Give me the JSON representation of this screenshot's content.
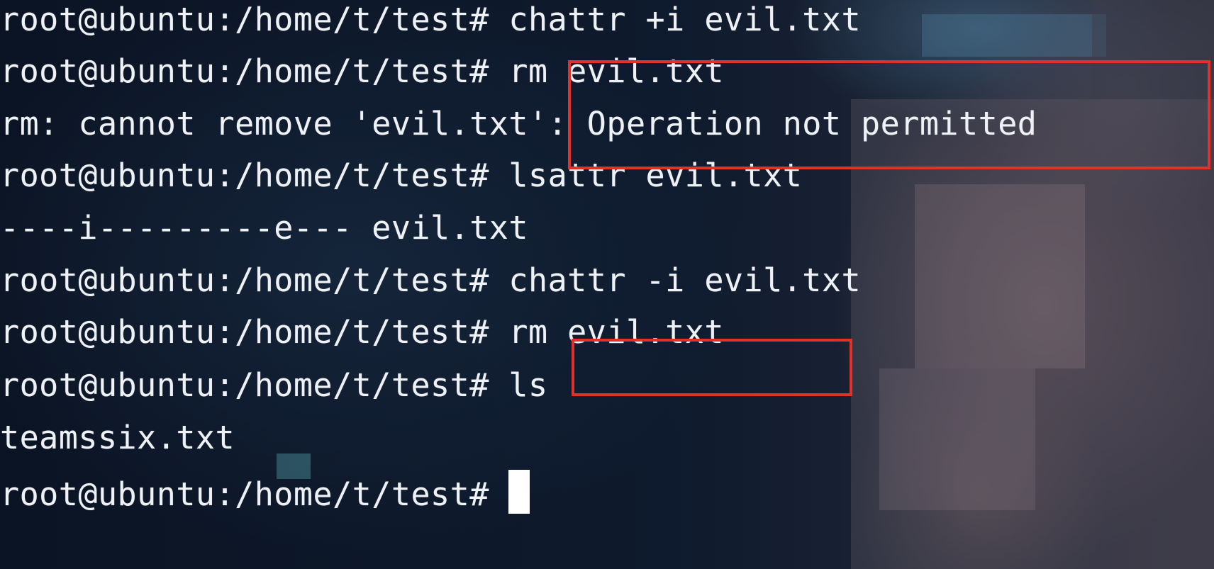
{
  "terminal": {
    "prompt": "root@ubuntu:/home/t/test# ",
    "lines": [
      {
        "prompt": "root@ubuntu:/home/t/test# ",
        "text": "chattr +i evil.txt"
      },
      {
        "prompt": "root@ubuntu:/home/t/test# ",
        "text": "rm evil.txt"
      },
      {
        "prompt": "",
        "text": "rm: cannot remove 'evil.txt': Operation not permitted"
      },
      {
        "prompt": "root@ubuntu:/home/t/test# ",
        "text": "lsattr evil.txt"
      },
      {
        "prompt": "",
        "text": "----i---------e--- evil.txt"
      },
      {
        "prompt": "root@ubuntu:/home/t/test# ",
        "text": "chattr -i evil.txt"
      },
      {
        "prompt": "root@ubuntu:/home/t/test# ",
        "text": "rm evil.txt"
      },
      {
        "prompt": "root@ubuntu:/home/t/test# ",
        "text": "ls"
      },
      {
        "prompt": "",
        "text": "teamssix.txt"
      },
      {
        "prompt": "root@ubuntu:/home/t/test# ",
        "text": ""
      }
    ]
  },
  "annotations": {
    "color": "#e0312b"
  },
  "colors": {
    "text": "#eef1f5",
    "background": "#0d1626"
  }
}
